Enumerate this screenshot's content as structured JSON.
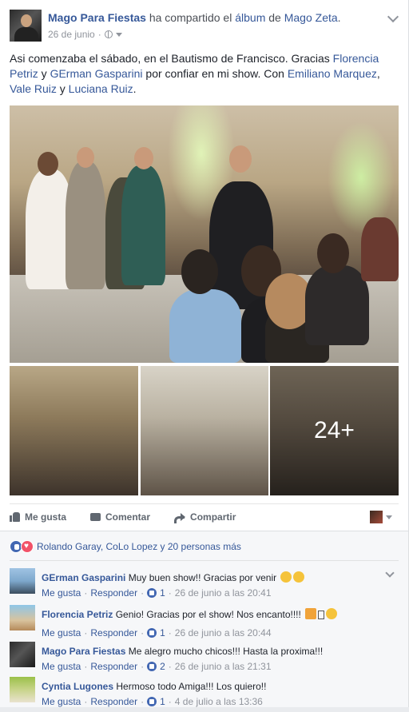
{
  "post": {
    "author": "Mago Para Fiestas",
    "shared_text": "ha compartido el",
    "album_word": "álbum",
    "of_word": "de",
    "album_owner": "Mago Zeta",
    "date": "26 de junio",
    "text_start": "Asi comenzaba el sábado, en el Bautismo de Francisco. Gracias ",
    "tag1": "Florencia Petriz",
    "and1": " y ",
    "tag2": "GErman Gasparini",
    "text_mid": " por confiar en mi show. Con ",
    "tag3": "Emiliano Marquez",
    "comma": ",",
    "tag4": "Vale Ruiz",
    "and2": " y ",
    "tag5": "Luciana Ruiz",
    "period": ".",
    "more_photos": "24+"
  },
  "actions": {
    "like": "Me gusta",
    "comment": "Comentar",
    "share": "Compartir"
  },
  "reactions": {
    "summary": "Rolando Garay, CoLo Lopez y 20 personas más"
  },
  "comments": [
    {
      "author": "GErman Gasparini",
      "text": "Muy buen show!! Gracias por venir",
      "like_label": "Me gusta",
      "reply_label": "Responder",
      "likes": "1",
      "time": "26 de junio a las 20:41"
    },
    {
      "author": "Florencia Petriz",
      "text": "Genio! Gracias por el show! Nos encanto!!!!",
      "like_label": "Me gusta",
      "reply_label": "Responder",
      "likes": "1",
      "time": "26 de junio a las 20:44"
    },
    {
      "author": "Mago Para Fiestas",
      "text": "Me alegro mucho chicos!!! Hasta la proxima!!!",
      "like_label": "Me gusta",
      "reply_label": "Responder",
      "likes": "2",
      "time": "26 de junio a las 21:31"
    },
    {
      "author": "Cyntia Lugones",
      "text": "Hermoso todo Amiga!!! Los quiero!!",
      "like_label": "Me gusta",
      "reply_label": "Responder",
      "likes": "1",
      "time": "4 de julio a las 13:36"
    }
  ],
  "colors": {
    "link": "#365899",
    "meta": "#90949c",
    "like_blue": "#4267b2",
    "love_red": "#f25268"
  }
}
